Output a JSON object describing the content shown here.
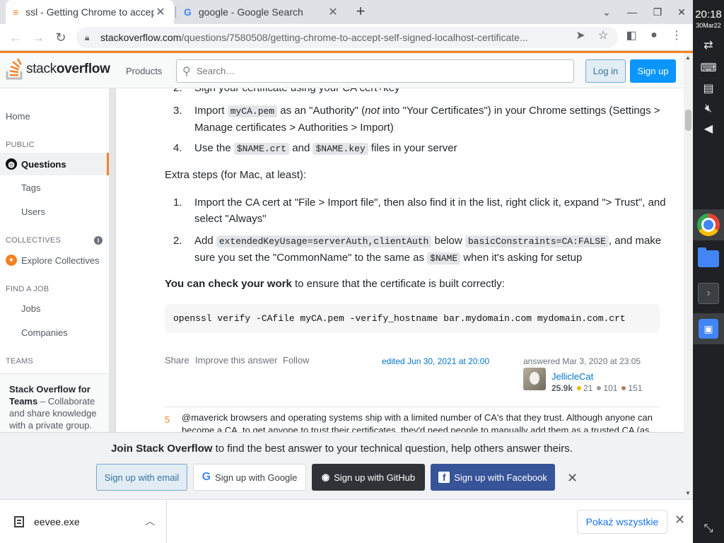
{
  "browser": {
    "tabs": [
      {
        "title": "ssl - Getting Chrome to accept",
        "close": "✕"
      },
      {
        "title": "google - Google Search",
        "close": "✕"
      }
    ],
    "new_tab": "+",
    "url_host": "stackoverflow.com",
    "url_path": "/questions/7580508/getting-chrome-to-accept-self-signed-localhost-certificate..."
  },
  "header": {
    "logo_stack": "stack",
    "logo_overflow": "overflow",
    "products": "Products",
    "search_placeholder": "Search…",
    "login": "Log in",
    "signup": "Sign up"
  },
  "sidebar": {
    "home": "Home",
    "public_label": "PUBLIC",
    "questions": "Questions",
    "tags": "Tags",
    "users": "Users",
    "collectives_label": "COLLECTIVES",
    "explore_collectives": "Explore Collectives",
    "find_job_label": "FIND A JOB",
    "jobs": "Jobs",
    "companies": "Companies",
    "teams_label": "TEAMS",
    "teams_title": "Stack Overflow for Teams",
    "teams_text": "– Collaborate and share knowledge with a private group."
  },
  "answer": {
    "step2_partial": "Sign your certificate using your CA cert+key",
    "step3_pre": "Import",
    "step3_code": "myCA.pem",
    "step3_mid": "as an \"Authority\" (",
    "step3_not": "not",
    "step3_post": "into \"Your Certificates\") in your Chrome settings (Settings > Manage certificates > Authorities > Import)",
    "step4_pre": "Use the",
    "step4_code1": "$NAME.crt",
    "step4_and": "and",
    "step4_code2": "$NAME.key",
    "step4_post": "files in your server",
    "extra_steps": "Extra steps (for Mac, at least):",
    "mac1": "Import the CA cert at \"File > Import file\", then also find it in the list, right click it, expand \"> Trust\", and select \"Always\"",
    "mac2_pre": "Add",
    "mac2_code1": "extendedKeyUsage=serverAuth,clientAuth",
    "mac2_below": "below",
    "mac2_code2": "basicConstraints=CA:FALSE",
    "mac2_mid": ", and make sure you set the \"CommonName\" to the same as",
    "mac2_code3": "$NAME",
    "mac2_post": "when it's asking for setup",
    "check_bold": "You can check your work",
    "check_rest": "to ensure that the certificate is built correctly:",
    "command": "openssl verify -CAfile myCA.pem -verify_hostname bar.mydomain.com mydomain.com.crt",
    "share": "Share",
    "improve": "Improve this answer",
    "follow": "Follow",
    "edited": "edited Jun 30, 2021 at 20:00",
    "answered": "answered Mar 3, 2020 at 23:05",
    "username": "JellicleCat",
    "reputation": "25.9k",
    "gold": "21",
    "silver": "101",
    "bronze": "151",
    "comment_score": "5",
    "comment_text": "@maverick browsers and operating systems ship with a limited number of CA's that they trust. Although anyone can become a CA, to get anyone to trust their certificates, they'd need people to manually add them as a trusted CA (as"
  },
  "banner": {
    "join_bold": "Join Stack Overflow",
    "join_rest": "to find the best answer to your technical question, help others answer theirs.",
    "email": "Sign up with email",
    "google": "Sign up with Google",
    "github": "Sign up with GitHub",
    "facebook": "Sign up with Facebook"
  },
  "downloads": {
    "file": "eevee.exe",
    "show_all": "Pokaż wszystkie"
  },
  "os": {
    "time": "20:18",
    "date": "30Mar22"
  },
  "colors": {
    "so_orange": "#f48225",
    "so_blue": "#0a95ff",
    "link_blue": "#0074cc"
  }
}
